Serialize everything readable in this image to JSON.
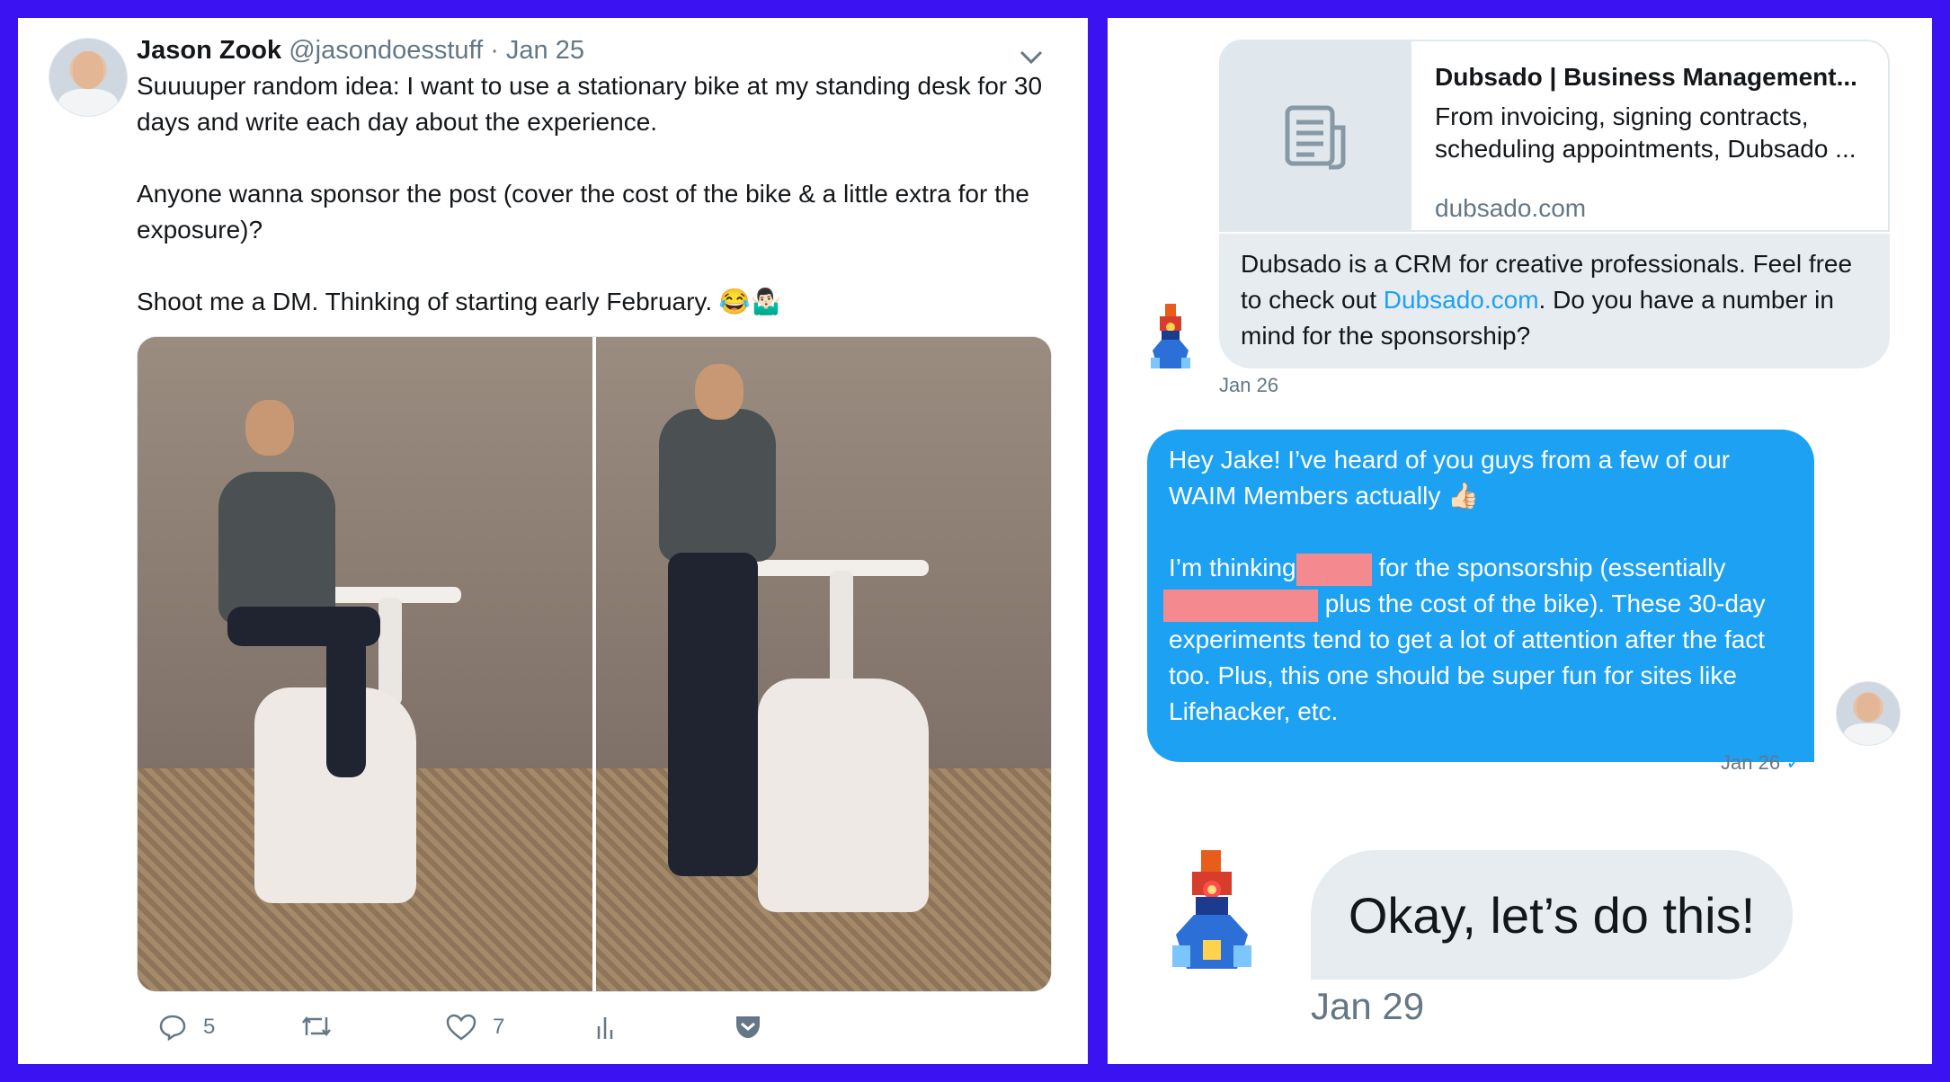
{
  "tweet": {
    "name": "Jason Zook",
    "handle": "@jasondoesstuff",
    "date": "· Jan 25",
    "para1": "Suuuuper random idea: I want to use a stationary bike at my standing desk for 30 days and write each day about the experience.",
    "para2": "Anyone wanna sponsor the post (cover the cost of the bike & a little extra for the exposure)?",
    "para3": "Shoot me a DM. Thinking of starting early February.",
    "emojis": "😂🤷🏻‍♂️",
    "reply_count": "5",
    "like_count": "7",
    "icons": [
      "reply-icon",
      "retweet-icon",
      "like-icon",
      "analytics-icon",
      "pocket-icon",
      "chevron-down-icon"
    ]
  },
  "dm": {
    "card_title": "Dubsado | Business Management...",
    "card_desc": "From invoicing, signing contracts, scheduling appointments, Dubsado ...",
    "card_domain": "dubsado.com",
    "msg1_a": "Dubsado is a CRM for creative professionals. Feel free to check out ",
    "msg1_link": "Dubsado.com",
    "msg1_b": ". Do you have a number in mind for the sponsorship?",
    "msg1_time": "Jan 26",
    "msg2_line1": "Hey Jake! I’ve heard of you guys from a few of our WAIM Members actually",
    "msg2_emoji": "👍🏻",
    "msg2_a": "I’m thinking",
    "msg2_b": "for the sponsorship (essentially",
    "msg2_c": "plus the cost of the bike). These 30-day experiments tend to get a lot of attention after the fact too. Plus, this one should be super fun for sites like Lifehacker, etc.",
    "msg2_time": "Jan 26",
    "msg2_check": "✓",
    "msg3": "Okay, let’s do this!",
    "msg3_time": "Jan 29"
  },
  "colors": {
    "background": "#3b12f2",
    "link": "#1da1f2",
    "bubble_in": "#e6ecf0",
    "redaction": "#f48a8f"
  }
}
